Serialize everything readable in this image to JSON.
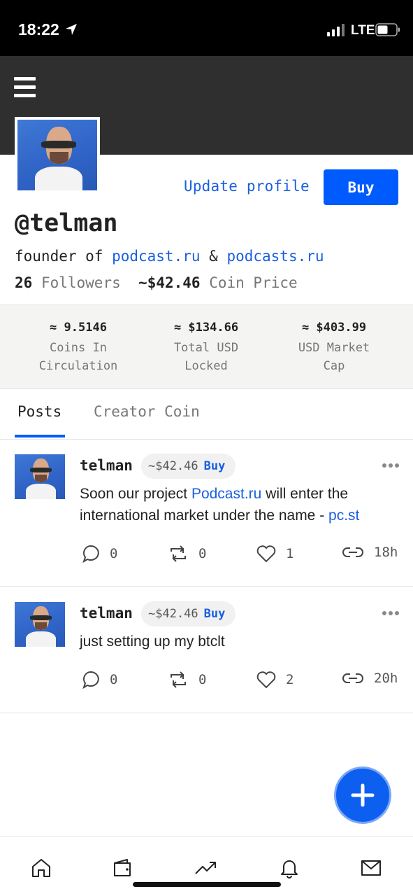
{
  "status_bar": {
    "time": "18:22",
    "network": "LTE"
  },
  "profile": {
    "username": "@telman",
    "update_profile_label": "Update profile",
    "buy_label": "Buy",
    "bio_prefix": "founder of ",
    "bio_link1": "podcast.ru",
    "bio_amp": " & ",
    "bio_link2": "podcasts.ru",
    "followers_count": "26",
    "followers_label": "Followers",
    "coin_price": "~$42.46",
    "coin_price_label": "Coin Price"
  },
  "stats": [
    {
      "value": "≈ 9.5146",
      "label_line1": "Coins In",
      "label_line2": "Circulation"
    },
    {
      "value": "≈ $134.66",
      "label_line1": "Total USD",
      "label_line2": "Locked"
    },
    {
      "value": "≈ $403.99",
      "label_line1": "USD Market",
      "label_line2": "Cap"
    }
  ],
  "tabs": [
    {
      "label": "Posts",
      "active": true
    },
    {
      "label": "Creator Coin",
      "active": false
    }
  ],
  "posts": [
    {
      "author": "telman",
      "price": "~$42.46",
      "buy_label": "Buy",
      "text_part1": "Soon our project ",
      "text_link1": "Podcast.ru",
      "text_part2": " will enter the international market under the name - ",
      "text_link2": "pc.st",
      "comments": "0",
      "reposts": "0",
      "likes": "1",
      "time": "18h"
    },
    {
      "author": "telman",
      "price": "~$42.46",
      "buy_label": "Buy",
      "text": "just setting up my btclt",
      "comments": "0",
      "reposts": "0",
      "likes": "2",
      "time": "20h"
    }
  ],
  "nav": [
    "home-icon",
    "wallet-icon",
    "trending-icon",
    "bell-icon",
    "mail-icon"
  ],
  "colors": {
    "accent": "#005bff",
    "link": "#1a5fe0",
    "header": "#2f2f2f"
  }
}
